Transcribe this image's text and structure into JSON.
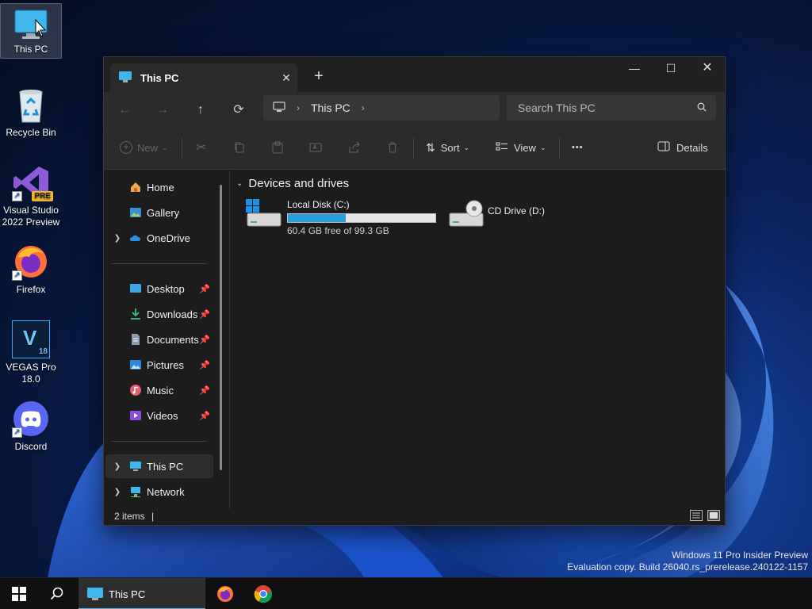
{
  "desktop": {
    "icons": [
      {
        "label": "This PC"
      },
      {
        "label": "Recycle Bin"
      },
      {
        "label": "Visual Studio 2022 Preview",
        "badge": "PRE"
      },
      {
        "label": "Firefox"
      },
      {
        "label": "VEGAS Pro 18.0",
        "glyph": "V",
        "badge": "18"
      },
      {
        "label": "Discord"
      }
    ]
  },
  "window": {
    "tab_title": "This PC",
    "tab_close": "✕",
    "new_tab": "+",
    "controls": {
      "minimize": "—",
      "maximize": "☐",
      "close": "✕"
    },
    "nav": {
      "back": "←",
      "forward": "→",
      "up": "↑",
      "refresh": "⟳"
    },
    "address": {
      "crumb": "This PC",
      "sep": "›"
    },
    "search": {
      "placeholder": "Search This PC"
    },
    "commands": {
      "new": "New",
      "sort": "Sort",
      "view": "View",
      "more": "•••",
      "details": "Details"
    },
    "sidebar": {
      "home": "Home",
      "gallery": "Gallery",
      "onedrive": "OneDrive",
      "desktop": "Desktop",
      "downloads": "Downloads",
      "documents": "Documents",
      "pictures": "Pictures",
      "music": "Music",
      "videos": "Videos",
      "thispc": "This PC",
      "network": "Network"
    },
    "content": {
      "group_header": "Devices and drives",
      "drives": [
        {
          "name": "Local Disk (C:)",
          "free_text": "60.4 GB free of 99.3 GB",
          "used_fraction": 0.392
        },
        {
          "name": "CD Drive (D:)"
        }
      ]
    },
    "status": {
      "items": "2 items",
      "caret": "|"
    }
  },
  "watermark": {
    "line1": "Windows 11 Pro Insider Preview",
    "line2": "Evaluation copy. Build 26040.rs_prerelease.240122-1157"
  },
  "taskbar": {
    "app_label": "This PC"
  },
  "colors": {
    "accent": "#26a0da",
    "taskbar_indicator": "#5fb2f2"
  }
}
